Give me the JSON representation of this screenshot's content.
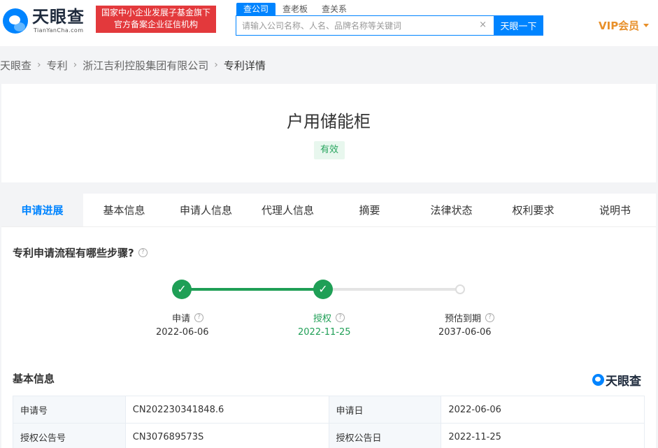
{
  "header": {
    "logo_text": "天眼查",
    "logo_sub": "TianYanCha.com",
    "badge_line1": "国家中小企业发展子基金旗下",
    "badge_line2": "官方备案企业征信机构",
    "search_tabs": [
      "查公司",
      "查老板",
      "查关系"
    ],
    "search_placeholder": "请输入公司名称、人名、品牌名称等关键词",
    "search_button": "天眼一下",
    "vip_label": "VIP会员",
    "brand_color": "#0084ff"
  },
  "breadcrumb": [
    "天眼查",
    "专利",
    "浙江吉利控股集团有限公司",
    "专利详情"
  ],
  "patent": {
    "title": "户用储能柜",
    "status": "有效"
  },
  "tabs": [
    "申请进展",
    "基本信息",
    "申请人信息",
    "代理人信息",
    "摘要",
    "法律状态",
    "权利要求",
    "说明书"
  ],
  "progress": {
    "title": "专利申请流程有哪些步骤?",
    "steps": [
      {
        "label": "申请",
        "date": "2022-06-06",
        "state": "done"
      },
      {
        "label": "授权",
        "date": "2022-11-25",
        "state": "done"
      },
      {
        "label": "预估到期",
        "date": "2037-06-06",
        "state": "pending"
      }
    ],
    "done_color": "#1f9f56"
  },
  "basic_info": {
    "title": "基本信息",
    "brand": "天眼查",
    "rows": [
      {
        "k1": "申请号",
        "v1": "CN202230341848.6",
        "k2": "申请日",
        "v2": "2022-06-06"
      },
      {
        "k1": "授权公告号",
        "v1": "CN307689573S",
        "k2": "授权公告日",
        "v2": "2022-11-25"
      }
    ]
  }
}
